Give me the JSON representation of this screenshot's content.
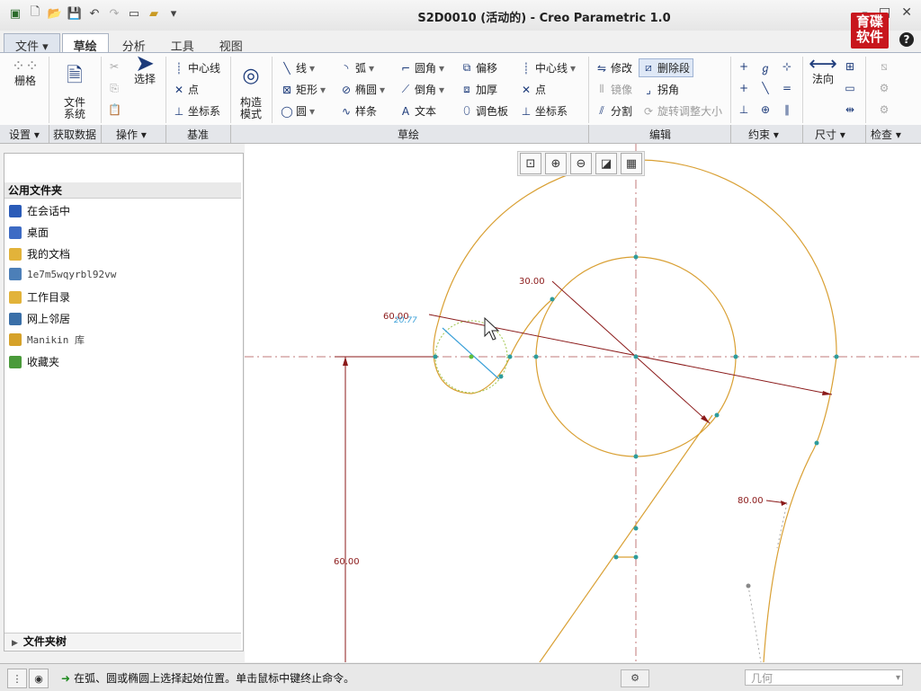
{
  "window": {
    "title": "S2D0010 (活动的) - Creo Parametric 1.0"
  },
  "quick_access": [
    "app-icon",
    "new-icon",
    "open-icon",
    "save-icon",
    "undo-icon",
    "redo-icon",
    "windows-icon",
    "folder-icon",
    "customize-icon"
  ],
  "logo": {
    "line1": "育碟",
    "line2": "软件"
  },
  "menu_tabs": [
    {
      "label": "文件 ▾",
      "name": "tab-file"
    },
    {
      "label": "草绘",
      "name": "tab-sketch",
      "active": true
    },
    {
      "label": "分析",
      "name": "tab-analysis"
    },
    {
      "label": "工具",
      "name": "tab-tools"
    },
    {
      "label": "视图",
      "name": "tab-view"
    }
  ],
  "ribbon": {
    "grid": "栅格",
    "file_system": "文件\n系统",
    "select": "选择",
    "datum": {
      "centerline": "中心线",
      "point": "点",
      "csys": "坐标系"
    },
    "construction": "构造\n模式",
    "sketch": {
      "line": "线",
      "rectangle": "矩形",
      "circle": "圆",
      "arc": "弧",
      "ellipse": "椭圆",
      "spline": "样条",
      "fillet": "圆角",
      "chamfer": "倒角",
      "text": "文本",
      "offset": "偏移",
      "thicken": "加厚",
      "palette": "调色板",
      "centerline": "中心线",
      "point": "点",
      "csys": "坐标系"
    },
    "edit": {
      "modify": "修改",
      "mirror": "镜像",
      "divide": "分割",
      "delete_segment": "删除段",
      "corner": "拐角",
      "rotate_resize": "旋转调整大小"
    },
    "dimension": {
      "normal": "法向"
    },
    "groups": [
      "设置 ▾",
      "获取数据",
      "操作 ▾",
      "基准",
      "草绘",
      "编辑",
      "约束 ▾",
      "尺寸 ▾",
      "检查 ▾"
    ]
  },
  "folder_panel": {
    "header": "公用文件夹",
    "items": [
      {
        "label": "在会话中",
        "icon": "session-icon",
        "color": "#2a5bb8"
      },
      {
        "label": "桌面",
        "icon": "desktop-icon",
        "color": "#3d6bc4"
      },
      {
        "label": "我的文档",
        "icon": "my-documents-icon",
        "color": "#e2b33a"
      },
      {
        "label": "1e7m5wqyrbl92vw",
        "icon": "computer-icon",
        "color": "#4c7fb8"
      },
      {
        "label": "工作目录",
        "icon": "working-directory-icon",
        "color": "#e2b33a"
      },
      {
        "label": "网上邻居",
        "icon": "network-icon",
        "color": "#3a6fa8"
      },
      {
        "label": "Manikin 库",
        "icon": "manikin-library-icon",
        "color": "#d6a22a"
      },
      {
        "label": "收藏夹",
        "icon": "favorites-icon",
        "color": "#4a9a3a"
      }
    ],
    "footer": "文件夹树"
  },
  "sketch": {
    "dimensions": [
      "30.00",
      "60.00",
      "20.77",
      "80.00",
      "60.00"
    ],
    "colors": {
      "geometry": "#d9a034",
      "dimension": "#8b1a1a",
      "centerline": "#c07a7a",
      "vertex": "#2e9c9c",
      "preview": "#3aa0d8"
    }
  },
  "status": {
    "message": "在弧、圆或椭圆上选择起始位置。单击鼠标中键终止命令。",
    "filter": "几何"
  }
}
